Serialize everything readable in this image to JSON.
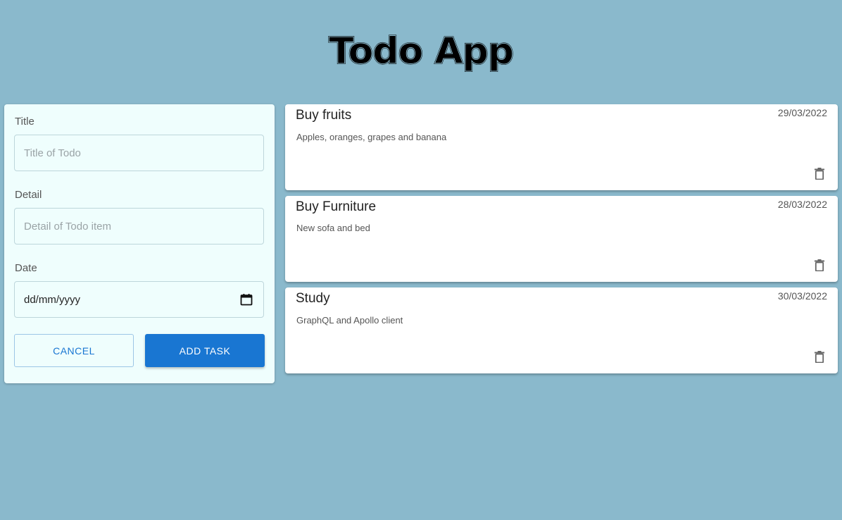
{
  "app": {
    "title": "Todo App"
  },
  "form": {
    "title_label": "Title",
    "title_placeholder": "Title of Todo",
    "title_value": "",
    "detail_label": "Detail",
    "detail_placeholder": "Detail of Todo item",
    "detail_value": "",
    "date_label": "Date",
    "date_placeholder": "dd/mm/yyyy",
    "cancel_label": "CANCEL",
    "add_label": "ADD TASK",
    "calendar_icon": "calendar-icon"
  },
  "todos": [
    {
      "title": "Buy fruits",
      "date": "29/03/2022",
      "detail": "Apples, oranges, grapes and banana",
      "icon": "delete-icon"
    },
    {
      "title": "Buy Furniture",
      "date": "28/03/2022",
      "detail": "New sofa and bed",
      "icon": "delete-icon"
    },
    {
      "title": "Study",
      "date": "30/03/2022",
      "detail": "GraphQL and Apollo client",
      "icon": "delete-icon"
    }
  ],
  "colors": {
    "background": "#8ab9cc",
    "form_background": "#effefd",
    "primary": "#1976d2",
    "card_background": "#ffffff"
  }
}
